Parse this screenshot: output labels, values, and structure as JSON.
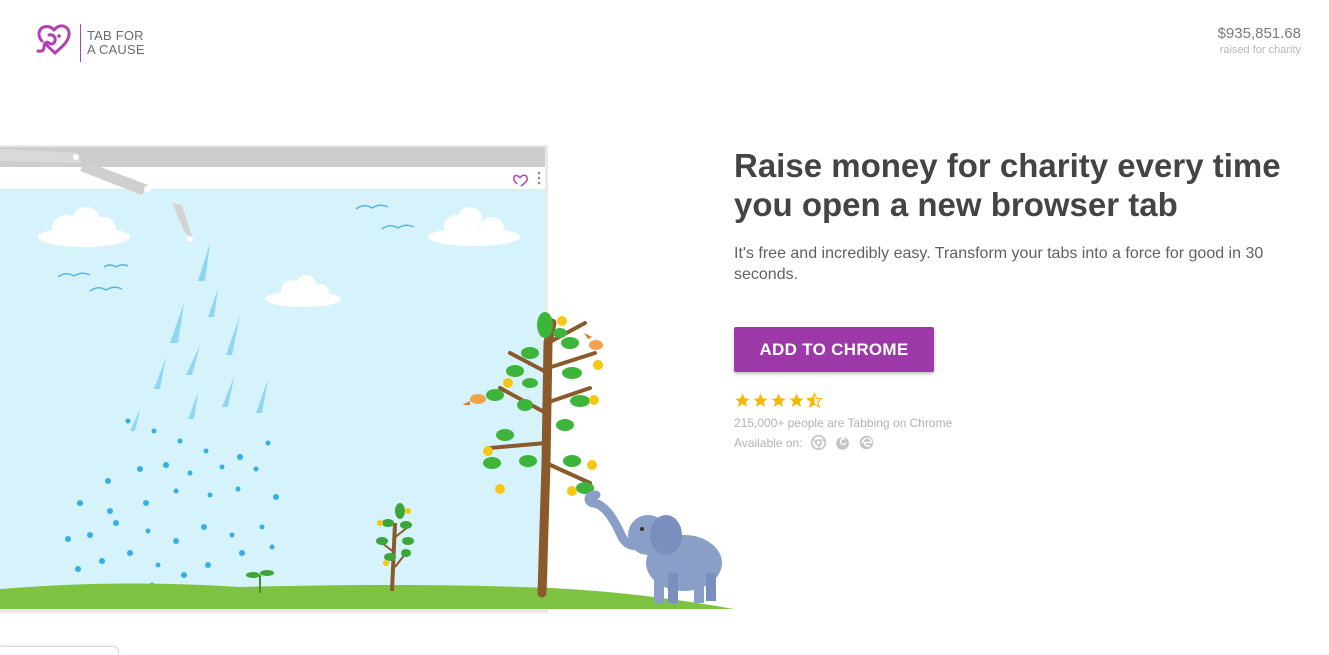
{
  "brand": {
    "name_line1": "TAB FOR",
    "name_line2": "A CAUSE",
    "accent_color": "#9d38a8"
  },
  "raised": {
    "amount": "$935,851.68",
    "label": "raised for charity"
  },
  "hero": {
    "headline": "Raise money for charity every time you open a new browser tab",
    "subline": "It's free and incredibly easy. Transform your tabs into a force for good in 30 seconds.",
    "cta_label": "ADD TO CHROME",
    "rating": 4.5,
    "users_text": "215,000+ people are Tabbing on Chrome",
    "available_label": "Available on:",
    "available_browsers": [
      "chrome-icon",
      "firefox-icon",
      "edge-icon"
    ]
  }
}
